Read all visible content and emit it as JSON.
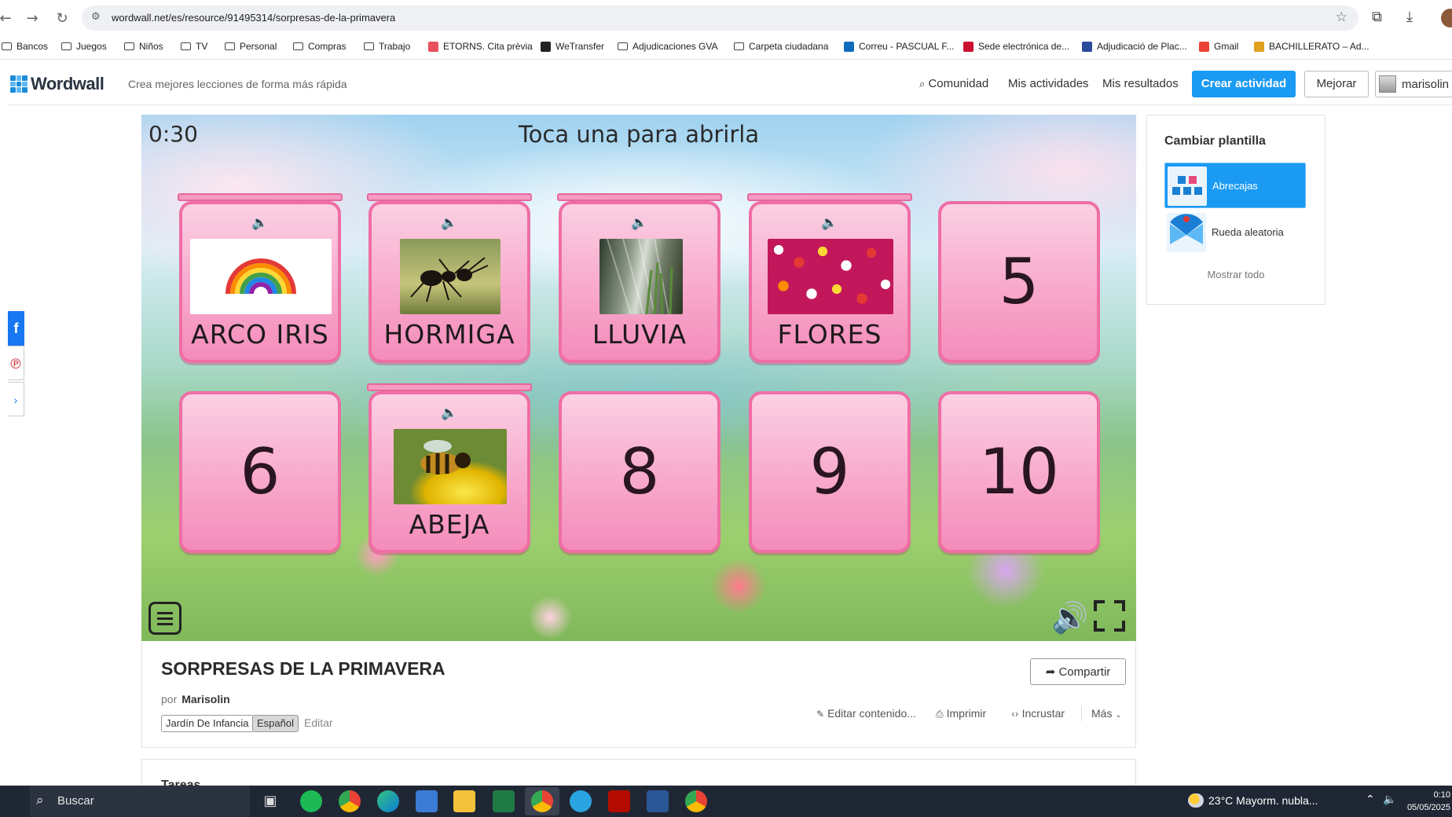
{
  "browser": {
    "url": "wordwall.net/es/resource/91495314/sorpresas-de-la-primavera",
    "bookmarks": [
      "Bancos",
      "Juegos",
      "Niños",
      "TV",
      "Personal",
      "Compras",
      "Trabajo",
      "ETORNS. Cita prèvia",
      "WeTransfer",
      "Adjudicaciones GVA",
      "Carpeta ciudadana",
      "Correu - PASCUAL F...",
      "Sede electrónica de...",
      "Adjudicació de Plac...",
      "Gmail",
      "BACHILLERATO – Ad..."
    ]
  },
  "header": {
    "logo": "Wordwall",
    "tagline": "Crea mejores lecciones de forma más rápida",
    "nav": [
      "Comunidad",
      "Mis actividades",
      "Mis resultados"
    ],
    "create_label": "Crear actividad",
    "upgrade_label": "Mejorar",
    "user": "marisolin"
  },
  "game": {
    "timer": "0:30",
    "instruction": "Toca una para abrirla",
    "cards": [
      {
        "state": "open",
        "label": "ARCO IRIS",
        "image": "rainbow"
      },
      {
        "state": "open",
        "label": "HORMIGA",
        "image": "ant"
      },
      {
        "state": "open",
        "label": "LLUVIA",
        "image": "rain"
      },
      {
        "state": "open",
        "label": "FLORES",
        "image": "flowers"
      },
      {
        "state": "closed",
        "number": "5"
      },
      {
        "state": "closed",
        "number": "6"
      },
      {
        "state": "open",
        "label": "ABEJA",
        "image": "bee"
      },
      {
        "state": "closed",
        "number": "8"
      },
      {
        "state": "closed",
        "number": "9"
      },
      {
        "state": "closed",
        "number": "10"
      }
    ]
  },
  "activity": {
    "title": "SORPRESAS DE LA PRIMAVERA",
    "by_prefix": "por",
    "author": "Marisolin",
    "tags": [
      "Jardín De Infancia",
      "Español"
    ],
    "edit_label": "Editar",
    "share_label": "Compartir",
    "actions": [
      "Editar contenido...",
      "Imprimir",
      "Incrustar",
      "Más"
    ],
    "tasks_label": "Tareas"
  },
  "templates": {
    "title": "Cambiar plantilla",
    "items": [
      "Abrecajas",
      "Rueda aleatoria"
    ],
    "show_all": "Mostrar todo"
  },
  "taskbar": {
    "search_placeholder": "Buscar",
    "weather": "23°C  Mayorm. nubla...",
    "time": "0:10",
    "date": "05/05/2025"
  },
  "colors": {
    "accent": "#1a9af3",
    "card_border": "#ef6ea4",
    "card_fill": "#f8a9cc"
  }
}
